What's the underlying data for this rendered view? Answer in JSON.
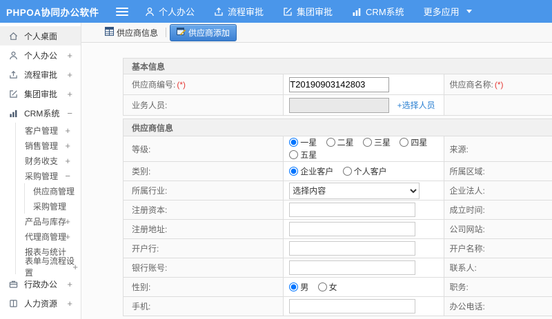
{
  "colors": {
    "header_blue": "#4a96ea",
    "tab_active_blue": "#3b7fd2",
    "link_blue": "#2a7fd1",
    "required_red": "#e53935"
  },
  "header": {
    "logo": "PHPOA协同办公软件",
    "nav": [
      {
        "label": "个人办公",
        "icon": "user-icon"
      },
      {
        "label": "流程审批",
        "icon": "process-icon"
      },
      {
        "label": "集团审批",
        "icon": "edit-icon"
      },
      {
        "label": "CRM系统",
        "icon": "chart-icon"
      },
      {
        "label": "更多应用",
        "icon": "caret-down-icon"
      }
    ]
  },
  "tabs": {
    "info": "供应商信息",
    "add": "供应商添加"
  },
  "sidebar": {
    "items": [
      {
        "label": "个人桌面",
        "icon": "home-icon",
        "active": true
      },
      {
        "label": "个人办公",
        "icon": "user-icon",
        "expand": "+"
      },
      {
        "label": "流程审批",
        "icon": "process-icon",
        "expand": "+"
      },
      {
        "label": "集团审批",
        "icon": "edit-icon",
        "expand": "+"
      },
      {
        "label": "CRM系统",
        "icon": "chart-icon",
        "expand": "−"
      },
      {
        "label": "客户管理",
        "expand": "+",
        "level": 2
      },
      {
        "label": "销售管理",
        "expand": "+",
        "level": 2
      },
      {
        "label": "财务收支",
        "expand": "+",
        "level": 2
      },
      {
        "label": "采购管理",
        "expand": "−",
        "level": 2
      },
      {
        "label": "供应商管理",
        "level": 3
      },
      {
        "label": "采购管理",
        "level": 3
      },
      {
        "label": "产品与库存",
        "expand": "+",
        "level": 2
      },
      {
        "label": "代理商管理",
        "expand": "+",
        "level": 2
      },
      {
        "label": "报表与统计",
        "level": 2
      },
      {
        "label": "表单与流程设置",
        "expand": "+",
        "level": 2
      },
      {
        "label": "行政办公",
        "icon": "briefcase-icon",
        "expand": "+"
      },
      {
        "label": "人力资源",
        "icon": "hr-icon",
        "expand": "+"
      }
    ]
  },
  "form": {
    "section1": {
      "title": "基本信息",
      "rows": [
        {
          "label": "供应商编号:",
          "required": "(*)",
          "value": "T20190903142803",
          "right_label": "供应商名称:",
          "right_required": "(*)"
        },
        {
          "label": "业务人员:",
          "link": "+选择人员",
          "right_label": ""
        }
      ]
    },
    "section2": {
      "title": "供应商信息",
      "rows": [
        {
          "label": "等级:",
          "type": "radio",
          "options": [
            "一星",
            "二星",
            "三星",
            "四星",
            "五星"
          ],
          "checked": 0,
          "right_label": "来源:"
        },
        {
          "label": "类别:",
          "type": "radio",
          "options": [
            "企业客户",
            "个人客户"
          ],
          "checked": 0,
          "right_label": "所属区域:"
        },
        {
          "label": "所属行业:",
          "type": "select",
          "value": "选择内容",
          "right_label": "企业法人:"
        },
        {
          "label": "注册资本:",
          "type": "input",
          "right_label": "成立时间:"
        },
        {
          "label": "注册地址:",
          "type": "input",
          "right_label": "公司网站:"
        },
        {
          "label": "开户行:",
          "type": "input",
          "right_label": "开户名称:"
        },
        {
          "label": "银行账号:",
          "type": "input",
          "right_label": "联系人:"
        },
        {
          "label": "性别:",
          "type": "radio",
          "options": [
            "男",
            "女"
          ],
          "checked": 0,
          "right_label": "职务:"
        },
        {
          "label": "手机:",
          "type": "input",
          "right_label": "办公电话:"
        }
      ]
    }
  }
}
